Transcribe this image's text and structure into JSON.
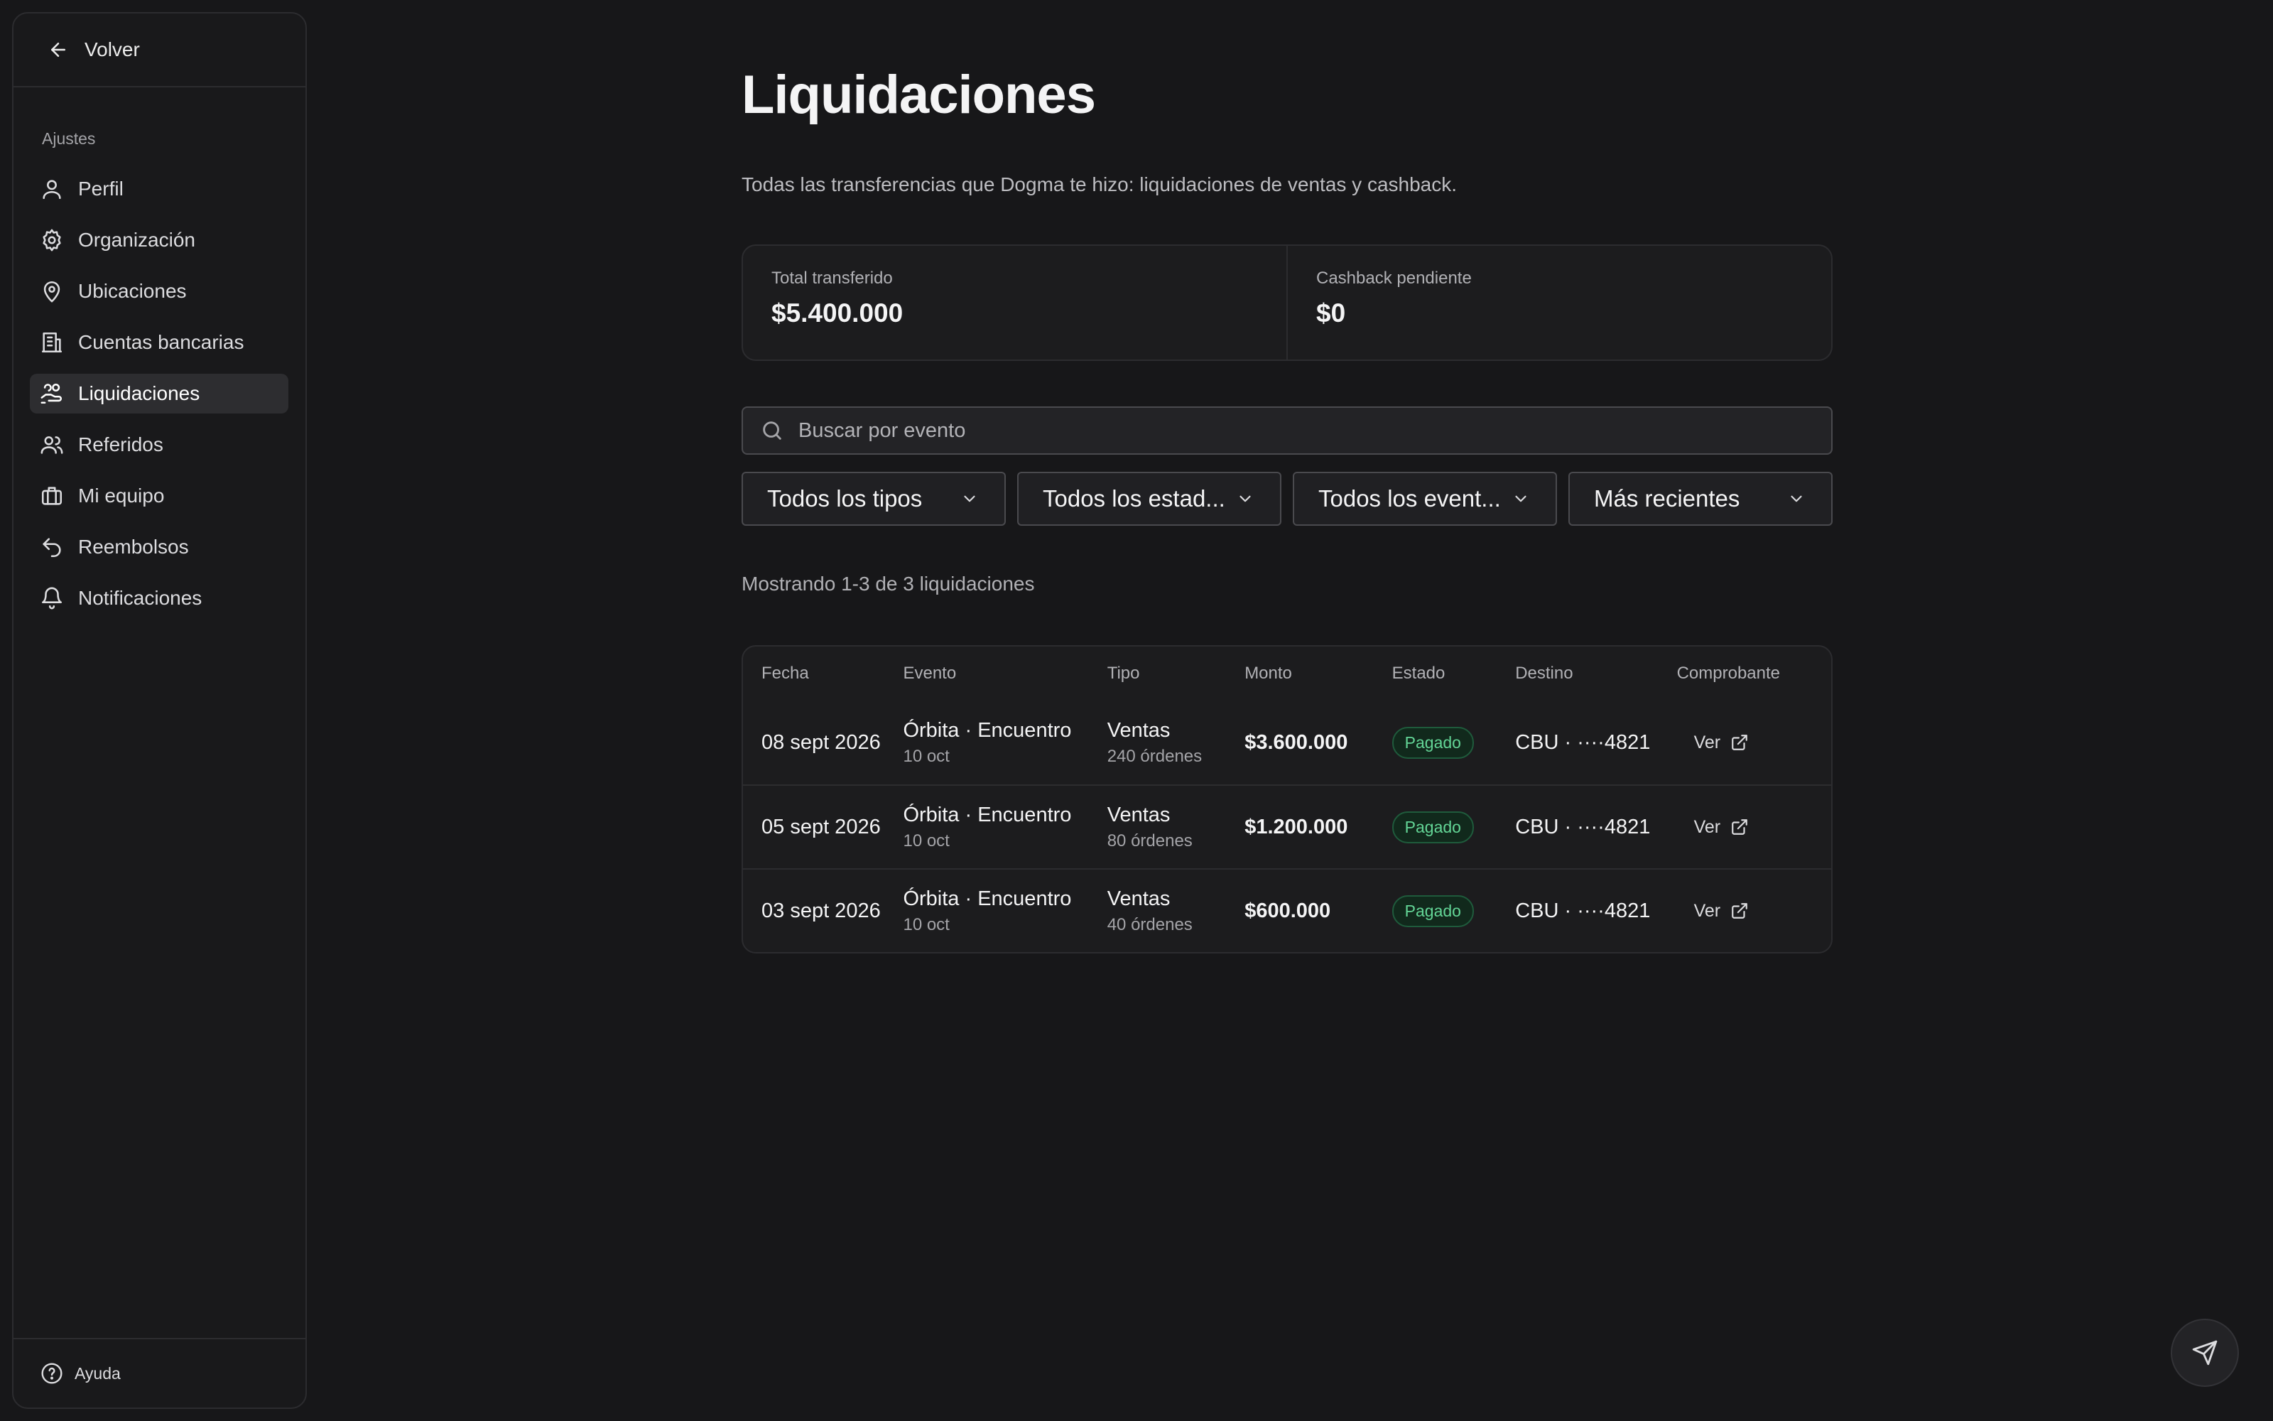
{
  "sidebar": {
    "back_label": "Volver",
    "section_label": "Ajustes",
    "items": [
      {
        "label": "Perfil",
        "icon": "user-icon",
        "active": false
      },
      {
        "label": "Organización",
        "icon": "gear-icon",
        "active": false
      },
      {
        "label": "Ubicaciones",
        "icon": "map-pin-icon",
        "active": false
      },
      {
        "label": "Cuentas bancarias",
        "icon": "bank-icon",
        "active": false
      },
      {
        "label": "Liquidaciones",
        "icon": "hand-coins-icon",
        "active": true
      },
      {
        "label": "Referidos",
        "icon": "users-icon",
        "active": false
      },
      {
        "label": "Mi equipo",
        "icon": "briefcase-icon",
        "active": false
      },
      {
        "label": "Reembolsos",
        "icon": "undo-icon",
        "active": false
      },
      {
        "label": "Notificaciones",
        "icon": "bell-icon",
        "active": false
      }
    ],
    "help_label": "Ayuda"
  },
  "page": {
    "title": "Liquidaciones",
    "subtitle": "Todas las transferencias que Dogma te hizo: liquidaciones de ventas y cashback."
  },
  "stats": {
    "total_label": "Total transferido",
    "total_value": "$5.400.000",
    "cashback_label": "Cashback pendiente",
    "cashback_value": "$0"
  },
  "search": {
    "placeholder": "Buscar por evento",
    "value": ""
  },
  "filters": {
    "type": "Todos los tipos",
    "status": "Todos los estad...",
    "event": "Todos los event...",
    "sort": "Más recientes"
  },
  "results_text": "Mostrando 1-3 de 3 liquidaciones",
  "table": {
    "headers": {
      "fecha": "Fecha",
      "evento": "Evento",
      "tipo": "Tipo",
      "monto": "Monto",
      "estado": "Estado",
      "destino": "Destino",
      "comprobante": "Comprobante"
    },
    "rows": [
      {
        "fecha": "08 sept 2026",
        "evento": "Órbita · Encuentro",
        "evento_fecha": "10 oct",
        "tipo": "Ventas",
        "ordenes": "240 órdenes",
        "monto": "$3.600.000",
        "estado": "Pagado",
        "destino": "CBU · ····4821",
        "comprobante": "Ver"
      },
      {
        "fecha": "05 sept 2026",
        "evento": "Órbita · Encuentro",
        "evento_fecha": "10 oct",
        "tipo": "Ventas",
        "ordenes": "80 órdenes",
        "monto": "$1.200.000",
        "estado": "Pagado",
        "destino": "CBU · ····4821",
        "comprobante": "Ver"
      },
      {
        "fecha": "03 sept 2026",
        "evento": "Órbita · Encuentro",
        "evento_fecha": "10 oct",
        "tipo": "Ventas",
        "ordenes": "40 órdenes",
        "monto": "$600.000",
        "estado": "Pagado",
        "destino": "CBU · ····4821",
        "comprobante": "Ver"
      }
    ]
  },
  "colors": {
    "background": "#171719",
    "badge_green": "#63d596",
    "active_nav": "#2d2d30"
  }
}
